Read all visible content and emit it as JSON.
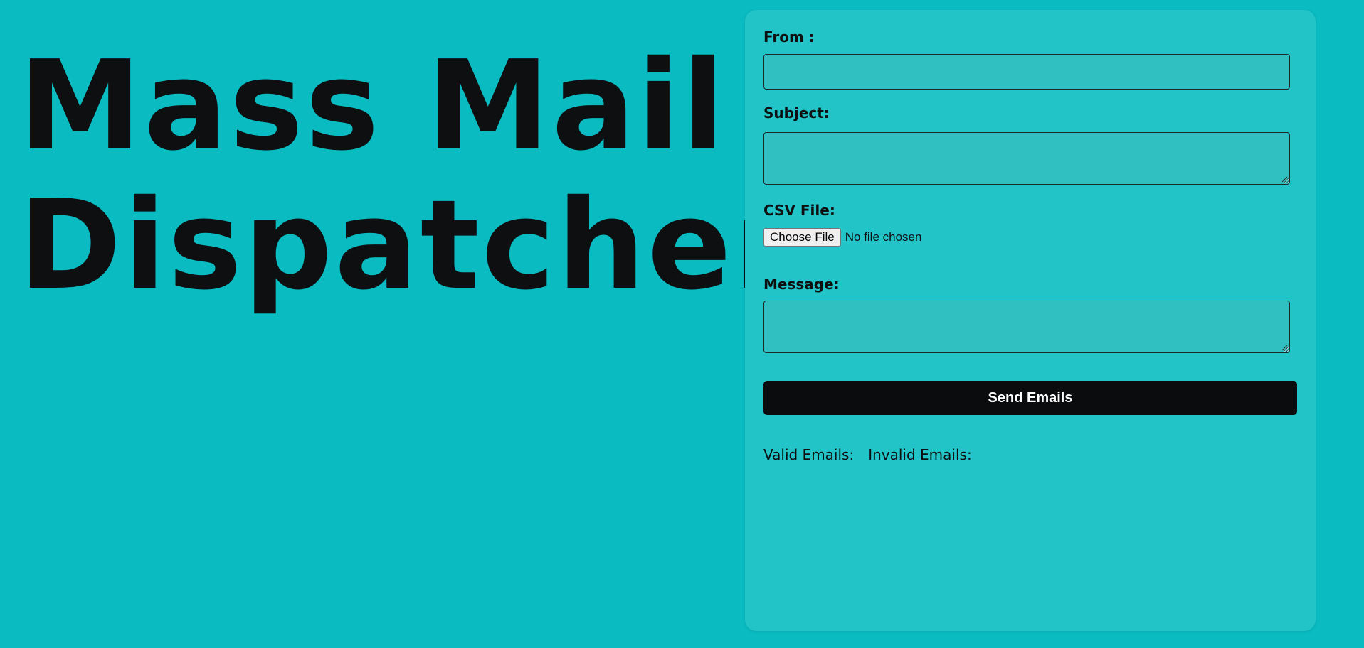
{
  "hero": {
    "line1": "Mass Mail",
    "line2": "Dispatcher"
  },
  "form": {
    "from_label": "From :",
    "from_value": "",
    "subject_label": "Subject:",
    "subject_value": "",
    "csv_label": "CSV File:",
    "choose_file_label": "Choose File",
    "no_file_text": "No file chosen",
    "message_label": "Message:",
    "message_value": "",
    "send_label": "Send Emails"
  },
  "stats": {
    "valid_label": "Valid Emails:",
    "invalid_label": "Invalid Emails:"
  },
  "colors": {
    "background": "#0abbc2",
    "panel": "#22c4c7",
    "input": "#31c0c1",
    "button": "#0b0c0d",
    "text": "#0e0f10"
  }
}
